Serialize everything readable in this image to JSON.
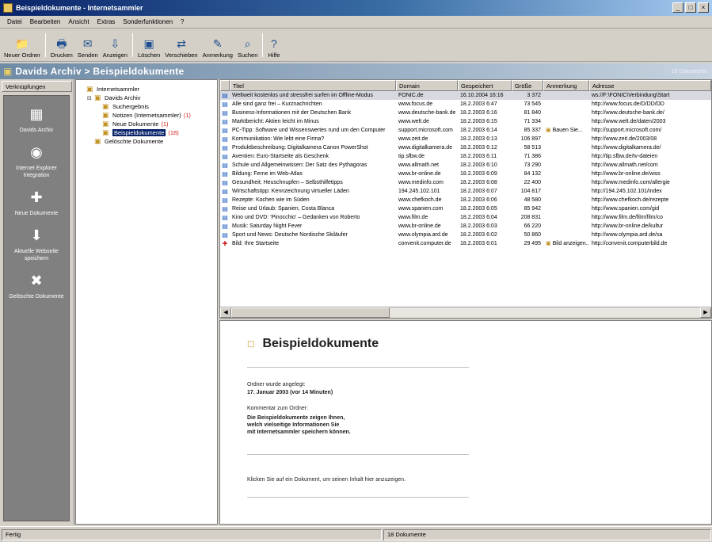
{
  "window": {
    "title": "Beispieldokumente - Internetsammler"
  },
  "menu": [
    "Datei",
    "Bearbeiten",
    "Ansicht",
    "Extras",
    "Sonderfunktionen",
    "?"
  ],
  "toolbar": [
    {
      "label": "Neuer Ordner",
      "icon": "new-folder-icon",
      "glyph": "📁"
    },
    {
      "label": "Drucken",
      "icon": "print-icon",
      "glyph": "🖶"
    },
    {
      "label": "Senden",
      "icon": "send-icon",
      "glyph": "✉"
    },
    {
      "label": "Anzeigen",
      "icon": "view-icon",
      "glyph": "⇩"
    },
    {
      "label": "Löschen",
      "icon": "delete-icon",
      "glyph": "▣"
    },
    {
      "label": "Verschieben",
      "icon": "move-icon",
      "glyph": "⇄"
    },
    {
      "label": "Anmerkung",
      "icon": "note-icon",
      "glyph": "✎"
    },
    {
      "label": "Suchen",
      "icon": "search-icon",
      "glyph": "⌕"
    },
    {
      "label": "Hilfe",
      "icon": "help-icon",
      "glyph": "?"
    }
  ],
  "folderbar": {
    "title": "Davids Archiv > Beispieldokumente",
    "right": "18 Dokumente"
  },
  "shortcuts_header": "Verknüpfungen",
  "shortcuts": [
    {
      "label": "Davids Archiv",
      "icon": "archive-icon",
      "glyph": "▦"
    },
    {
      "label": "Internet Explorer Integration",
      "icon": "globe-icon",
      "glyph": "◉"
    },
    {
      "label": "Neue Dokumente",
      "icon": "new-documents-icon",
      "glyph": "✚"
    },
    {
      "label": "Aktuelle Webseite speichern",
      "icon": "save-page-icon",
      "glyph": "⬇"
    },
    {
      "label": "Gelöschte Dokumente",
      "icon": "trash-icon",
      "glyph": "✖"
    }
  ],
  "tree": [
    {
      "label": "Internetsammler",
      "level": 0,
      "twisty": "",
      "selected": false,
      "count": ""
    },
    {
      "label": "Davids Archiv",
      "level": 1,
      "twisty": "⊟",
      "selected": false,
      "count": ""
    },
    {
      "label": "Suchergebnis",
      "level": 2,
      "twisty": "",
      "selected": false,
      "count": ""
    },
    {
      "label": "Notizen (Internetsammler)",
      "level": 2,
      "twisty": "",
      "selected": false,
      "count": "(1)"
    },
    {
      "label": "Neue Dokumente",
      "level": 2,
      "twisty": "",
      "selected": false,
      "count": "(1)"
    },
    {
      "label": "Beispieldokumente",
      "level": 2,
      "twisty": "",
      "selected": true,
      "count": "(18)"
    },
    {
      "label": "Gelöschte Dokumente",
      "level": 1,
      "twisty": "",
      "selected": false,
      "count": ""
    }
  ],
  "list": {
    "columns": [
      "",
      "Titel",
      "Domain",
      "Gespeichert",
      "Größe",
      "Anmerkung",
      "Adresse"
    ],
    "rows": [
      {
        "title": "Weltweit kostenlos und stressfrei surfen im Offline-Modus",
        "domain": "FONIC.de",
        "date": "16.10.2004 16:16",
        "size": "3 372",
        "note": "",
        "url": "ws://F:\\FONIC\\Verbindung\\Start",
        "flag": "blue"
      },
      {
        "title": "Alle sind ganz frei – Kurznachrichten",
        "domain": "www.focus.de",
        "date": "18.2.2003 6:47",
        "size": "73 545",
        "note": "",
        "url": "http://www.focus.de/D/DD/DD",
        "flag": "blue"
      },
      {
        "title": "Business-Informationen mit der Deutschen Bank",
        "domain": "www.deutsche-bank.de",
        "date": "18.2.2003 6:16",
        "size": "81 840",
        "note": "",
        "url": "http://www.deutsche-bank.de/",
        "flag": "blue"
      },
      {
        "title": "Marktbericht: Aktien leicht im Minus",
        "domain": "www.welt.de",
        "date": "18.2.2003 6:15",
        "size": "71 334",
        "note": "",
        "url": "http://www.welt.de/daten/2003",
        "flag": "blue"
      },
      {
        "title": "PC-Tipp: Software und Wissenswertes rund um den Computer",
        "domain": "support.microsoft.com",
        "date": "18.2.2003 6:14",
        "size": "85 337",
        "note": "Bauen Sie...",
        "url": "http://support.microsoft.com/",
        "flag": "blue"
      },
      {
        "title": "Kommunikation: Wie lebt eine Firma?",
        "domain": "www.zeit.de",
        "date": "18.2.2003 6:13",
        "size": "106 897",
        "note": "",
        "url": "http://www.zeit.de/2003/08",
        "flag": "blue"
      },
      {
        "title": "Produktbeschreibung: Digitalkamera Canon PowerShot",
        "domain": "www.digitalkamera.de",
        "date": "18.2.2003 6:12",
        "size": "58 513",
        "note": "",
        "url": "http://www.digitalkamera.de/",
        "flag": "blue"
      },
      {
        "title": "Aventien: Euro-Startseite als Geschenk",
        "domain": "tip.sfbw.de",
        "date": "18.2.2003 6:11",
        "size": "71 386",
        "note": "",
        "url": "http://tip.sfbw.de/tv-dateien",
        "flag": "blue"
      },
      {
        "title": "Schule und Allgemeinwissen: Der Satz des Pythagoras",
        "domain": "www.allmath.net",
        "date": "18.2.2003 6:10",
        "size": "73 290",
        "note": "",
        "url": "http://www.allmath.net/com",
        "flag": "blue"
      },
      {
        "title": "Bildung: Ferne im Web-Atlas",
        "domain": "www.br-online.de",
        "date": "18.2.2003 6:09",
        "size": "84 132",
        "note": "",
        "url": "http://www.br-online.de/wiss",
        "flag": "blue"
      },
      {
        "title": "Gesundheit: Heuschnupfen – Selbsthilfetipps",
        "domain": "www.medinfo.com",
        "date": "18.2.2003 6:08",
        "size": "22 400",
        "note": "",
        "url": "http://www.medinfo.com/allergie",
        "flag": "blue"
      },
      {
        "title": "Wirtschaftstipp: Kennzeichnung virtueller Läden",
        "domain": "194.245.102.101",
        "date": "18.2.2003 6:07",
        "size": "104 817",
        "note": "",
        "url": "http://194.245.102.101/index",
        "flag": "blue"
      },
      {
        "title": "Rezepte: Kochen wie im Süden",
        "domain": "www.chefkoch.de",
        "date": "18.2.2003 6:06",
        "size": "48 580",
        "note": "",
        "url": "http://www.chefkoch.de/rezepte",
        "flag": "blue"
      },
      {
        "title": "Reise und Urlaub: Spanien, Costa Blanca",
        "domain": "www.spanien.com",
        "date": "18.2.2003 6:05",
        "size": "85 942",
        "note": "",
        "url": "http://www.spanien.com/gid",
        "flag": "blue"
      },
      {
        "title": "Kino und DVD: 'Pinocchio' – Gedanken von Roberto",
        "domain": "www.film.de",
        "date": "18.2.2003 6:04",
        "size": "208 831",
        "note": "",
        "url": "http://www.film.de/film/film/co",
        "flag": "blue"
      },
      {
        "title": "Musik: Saturday Night Fever",
        "domain": "www.br-online.de",
        "date": "18.2.2003 6:03",
        "size": "66 220",
        "note": "",
        "url": "http://www.br-online.de/kultur",
        "flag": "blue"
      },
      {
        "title": "Sport und News: Deutsche Nordische Skiläufer",
        "domain": "www.olympia.ard.de",
        "date": "18.2.2003 6:02",
        "size": "50 860",
        "note": "",
        "url": "http://www.olympia.ard.de/sa",
        "flag": "blue"
      },
      {
        "title": "Bild: Ihre Startseite",
        "domain": "convenit.computer.de",
        "date": "18.2.2003 6:01",
        "size": "29 495",
        "note": "Bild anzeigen...",
        "url": "http://convenit.computerbild.de",
        "flag": "red"
      }
    ]
  },
  "preview": {
    "title": "Beispieldokumente",
    "created_label": "Ordner wurde angelegt:",
    "created_value": "17. Januar 2003 (vor 14 Minuten)",
    "comment_label": "Kommentar zum Ordner:",
    "comment_lines": [
      "Die Beispieldokumente zeigen Ihnen,",
      "welch vielseitige Informationen Sie",
      "mit Internetsammler speichern können."
    ],
    "hint": "Klicken Sie auf ein Dokument, um seinen Inhalt hier anzuzeigen."
  },
  "status": {
    "left": "Fertig",
    "center": "18 Dokumente"
  }
}
